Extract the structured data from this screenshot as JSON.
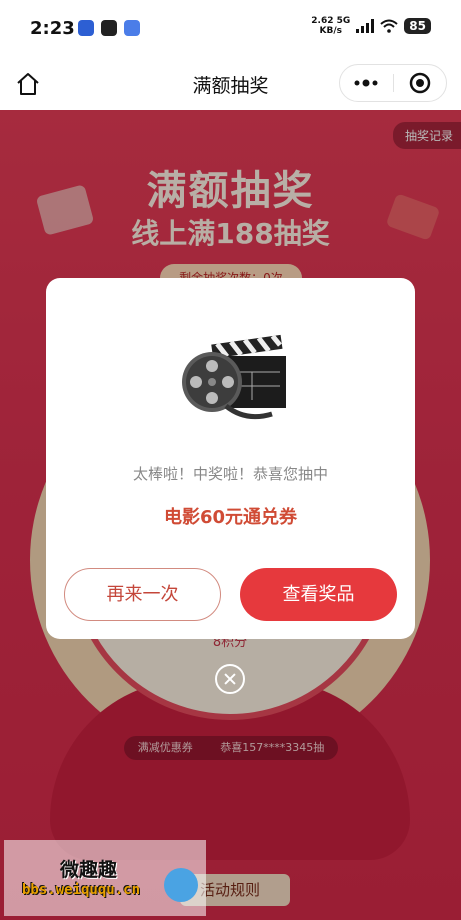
{
  "status_bar": {
    "time": "2:23",
    "net_speed": "2.62",
    "net_speed_unit": "KB/s",
    "network_type": "5G",
    "battery": "85",
    "icons": [
      "baidu-icon",
      "qq-icon",
      "browser-icon",
      "signal-icon",
      "wifi-icon",
      "battery-icon"
    ]
  },
  "nav": {
    "title": "满额抽奖",
    "icons": [
      "home-icon",
      "more-icon",
      "close-target-icon"
    ]
  },
  "background": {
    "history_label": "抽奖记录",
    "title": "满额抽奖",
    "subtitle": "线上满188抽奖",
    "chances_label": "剩余抽奖次数：0次",
    "wheel_label": "8积分",
    "marquee": [
      "满减优惠券",
      "恭喜157****3345抽"
    ],
    "rules_label": "活动规则"
  },
  "modal": {
    "prize_icon": "film-clapper-icon",
    "message": "太棒啦！中奖啦！恭喜您抽中",
    "prize": "电影60元通兑券",
    "again_button": "再来一次",
    "view_button": "查看奖品",
    "close_icon": "close-circle-icon"
  },
  "watermark": {
    "title": "微趣趣",
    "url": "bbs.weiququ.cn"
  },
  "colors": {
    "page_red": "#dc3150",
    "button_red": "#e6393d",
    "prize_text": "#d04b35"
  }
}
